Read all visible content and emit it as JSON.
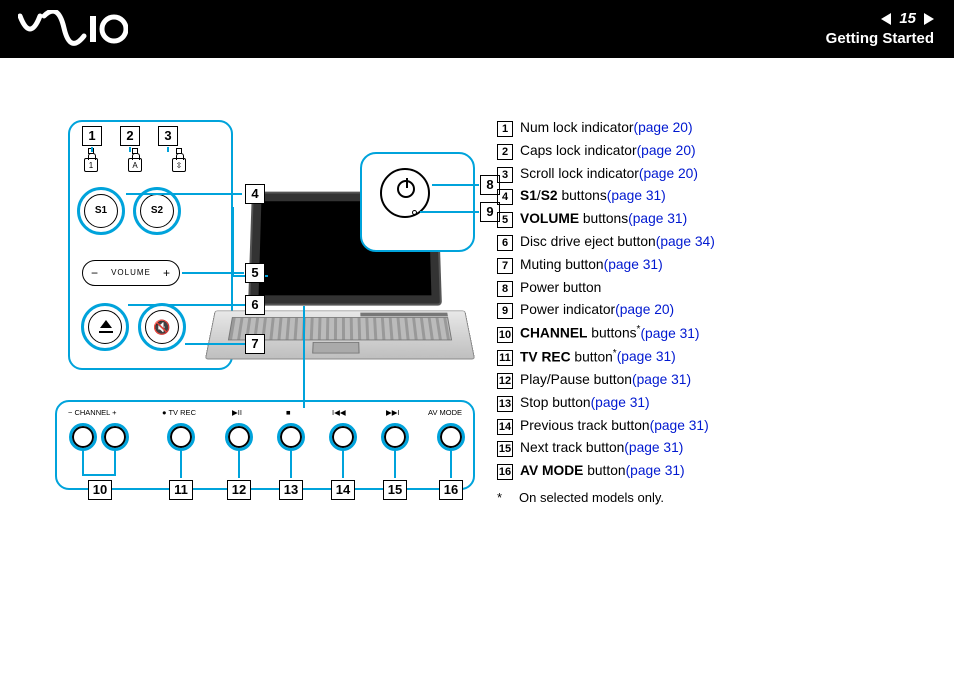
{
  "header": {
    "logo_alt": "VAIO",
    "page_number": "15",
    "section": "Getting Started"
  },
  "diagram": {
    "locks": [
      "1",
      "A",
      "↕"
    ],
    "s1": "S1",
    "s2": "S2",
    "volume": "VOLUME",
    "mute_glyph": "✕",
    "strip": {
      "channel": "− CHANNEL +",
      "tvrec": "● TV REC",
      "play": "▶II",
      "stop": "■",
      "prev": "I◀◀",
      "next": "▶▶I",
      "avmode": "AV MODE"
    },
    "dnums": [
      "1",
      "2",
      "3",
      "4",
      "5",
      "6",
      "7",
      "8",
      "9",
      "10",
      "11",
      "12",
      "13",
      "14",
      "15",
      "16"
    ]
  },
  "legend": [
    {
      "n": "1",
      "pre": "",
      "bold": "",
      "post": "Num lock indicator ",
      "link": "(page 20)"
    },
    {
      "n": "2",
      "pre": "",
      "bold": "",
      "post": "Caps lock indicator ",
      "link": "(page 20)"
    },
    {
      "n": "3",
      "pre": "",
      "bold": "",
      "post": "Scroll lock indicator ",
      "link": "(page 20)"
    },
    {
      "n": "4",
      "pre": "",
      "bold": "S1",
      "mid": "/",
      "bold2": "S2",
      "post": " buttons ",
      "link": "(page 31)"
    },
    {
      "n": "5",
      "pre": "",
      "bold": "VOLUME",
      "post": " buttons ",
      "link": "(page 31)"
    },
    {
      "n": "6",
      "pre": "",
      "bold": "",
      "post": "Disc drive eject button ",
      "link": "(page 34)"
    },
    {
      "n": "7",
      "pre": "",
      "bold": "",
      "post": "Muting button ",
      "link": "(page 31)"
    },
    {
      "n": "8",
      "pre": "",
      "bold": "",
      "post": "Power button",
      "link": ""
    },
    {
      "n": "9",
      "pre": "",
      "bold": "",
      "post": "Power indicator ",
      "link": "(page 20)"
    },
    {
      "n": "10",
      "pre": "",
      "bold": "CHANNEL",
      "post": " buttons",
      "ast": "*",
      "post2": " ",
      "link": "(page 31)"
    },
    {
      "n": "11",
      "pre": "",
      "bold": "TV REC",
      "post": " button",
      "ast": "*",
      "post2": " ",
      "link": "(page 31)"
    },
    {
      "n": "12",
      "pre": "",
      "bold": "",
      "post": "Play/Pause button ",
      "link": "(page 31)"
    },
    {
      "n": "13",
      "pre": "",
      "bold": "",
      "post": "Stop button ",
      "link": "(page 31)"
    },
    {
      "n": "14",
      "pre": "",
      "bold": "",
      "post": "Previous track button ",
      "link": "(page 31)"
    },
    {
      "n": "15",
      "pre": "",
      "bold": "",
      "post": "Next track button ",
      "link": "(page 31)"
    },
    {
      "n": "16",
      "pre": "",
      "bold": "AV MODE",
      "post": " button ",
      "link": "(page 31)"
    }
  ],
  "footnote": {
    "mark": "*",
    "text": "On selected models only."
  }
}
